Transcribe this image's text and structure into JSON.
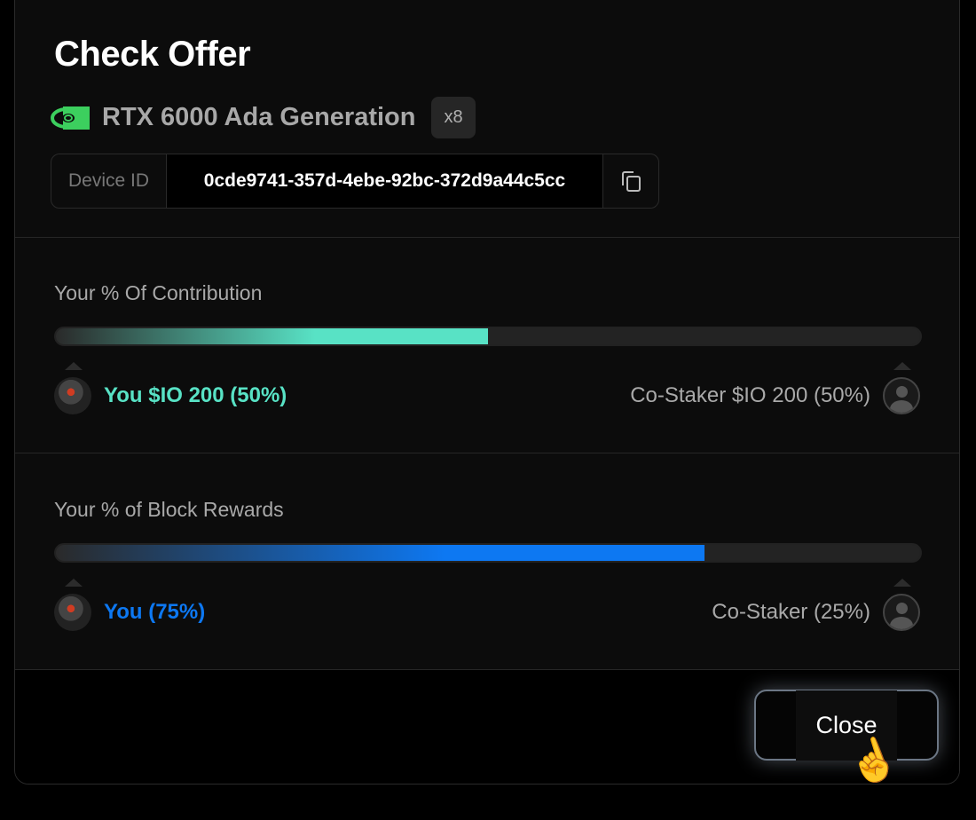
{
  "title": "Check Offer",
  "gpu": {
    "name": "RTX 6000 Ada Generation",
    "count": "x8",
    "icon": "nvidia-logo-icon",
    "brand_color": "#3ccf5e"
  },
  "device": {
    "label": "Device ID",
    "value": "0cde9741-357d-4ebe-92bc-372d9a44c5cc"
  },
  "contribution": {
    "label": "Your % Of Contribution",
    "fill_percent": 50,
    "color": "#58e2c5",
    "you": "You $IO 200 (50%)",
    "costaker": "Co-Staker $IO 200 (50%)"
  },
  "rewards": {
    "label": "Your % of Block Rewards",
    "fill_percent": 75,
    "color": "#0d78f2",
    "you": "You (75%)",
    "costaker": "Co-Staker (25%)"
  },
  "close_label": "Close"
}
